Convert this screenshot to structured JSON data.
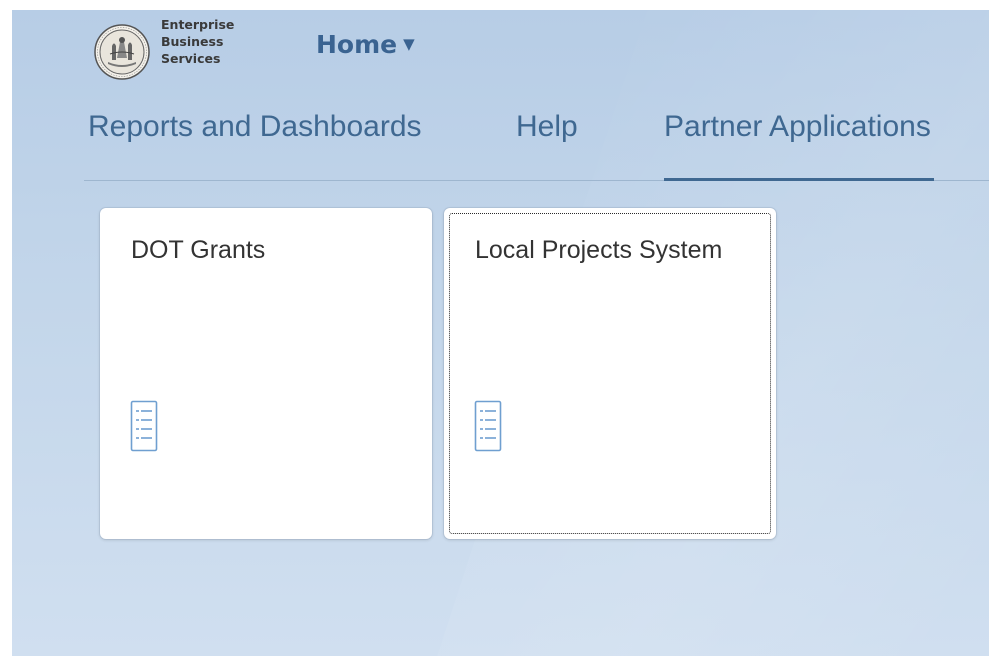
{
  "header": {
    "brand_lines": [
      "Enterprise",
      "Business",
      "Services"
    ],
    "home_label": "Home",
    "home_caret": "▼"
  },
  "tabs": [
    {
      "label": "Reports and Dashboards",
      "selected": false
    },
    {
      "label": "Help",
      "selected": false
    },
    {
      "label": "Partner Applications",
      "selected": true
    }
  ],
  "tiles": [
    {
      "title": "DOT Grants",
      "icon": "document-list-icon",
      "focused": false
    },
    {
      "title": "Local Projects System",
      "icon": "document-list-icon",
      "focused": true
    }
  ],
  "colors": {
    "accent": "#3f6891",
    "home_link": "#3a6391",
    "background": "#c3d6ea",
    "tile_background": "#ffffff",
    "icon": "#6f9fd0"
  }
}
